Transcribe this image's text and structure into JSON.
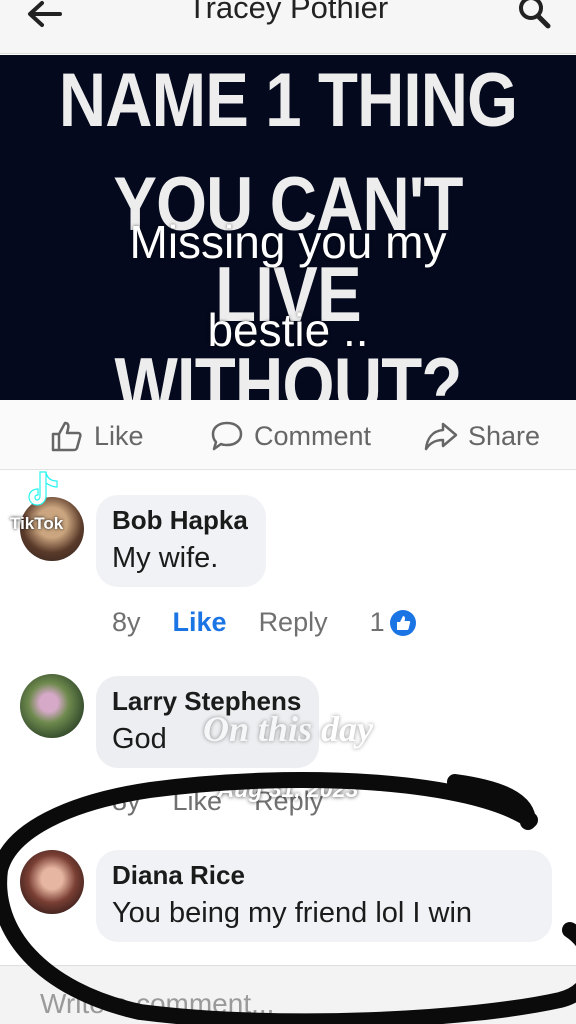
{
  "header": {
    "title": "Tracey Pothier",
    "back_icon": "arrow-left-icon",
    "search_icon": "search-icon"
  },
  "post_image": {
    "meme_line1": "NAME 1 THING",
    "meme_line2": "YOU CAN'T",
    "meme_line3": "LIVE WITHOUT?",
    "caption_line1": "Missing you my",
    "caption_line2": "bestie .."
  },
  "actions": {
    "like": "Like",
    "comment": "Comment",
    "share": "Share"
  },
  "comments": [
    {
      "name": "Bob Hapka",
      "text": "My wife.",
      "age": "8y",
      "like": "Like",
      "reply": "Reply",
      "reactions": "1"
    },
    {
      "name": "Larry Stephens",
      "text": "God",
      "age": "8y",
      "like": "Like",
      "reply": "Reply"
    },
    {
      "name": "Diana Rice",
      "text": "You being my friend lol I win"
    }
  ],
  "overlay": {
    "watermark": "TikTok",
    "on_this_day": "On this day",
    "date": "Aug 31, 2023"
  },
  "composer": {
    "placeholder": "Write a comment..."
  },
  "colors": {
    "accent": "#1b74e4",
    "image_bg": "#04091d",
    "bubble": "#f0f2f5"
  }
}
